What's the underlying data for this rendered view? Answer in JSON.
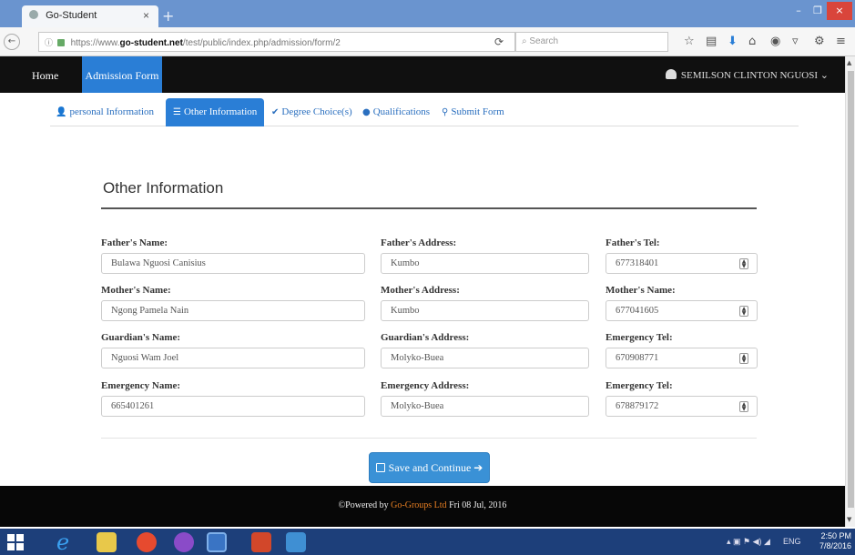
{
  "browser": {
    "tab_title": "Go-Student",
    "tab_close": "×",
    "new_tab": "+",
    "url_prefix": "https://www.",
    "url_domain": "go-student.net",
    "url_path": "/test/public/index.php/admission/form/2",
    "search_placeholder": "Search",
    "window_min": "–",
    "window_max": "❐",
    "window_close": "×"
  },
  "app": {
    "nav_home": "Home",
    "nav_admission": "Admission Form",
    "user_name": "SEMILSON CLINTON NGUOSI",
    "user_caret": "⌄"
  },
  "pills": [
    {
      "icon": "user-icon",
      "label": "personal Information"
    },
    {
      "icon": "list-icon",
      "label": "Other Information"
    },
    {
      "icon": "check-icon",
      "label": "Degree Choice(s)"
    },
    {
      "icon": "circle-icon",
      "label": "Qualifications"
    },
    {
      "icon": "pin-icon",
      "label": "Submit Form"
    }
  ],
  "form": {
    "title": "Other Information",
    "fields": [
      {
        "label": "Father's Name:",
        "value": "Bulawa Nguosi Canisius"
      },
      {
        "label": "Father's Address:",
        "value": "Kumbo"
      },
      {
        "label": "Father's Tel:",
        "value": "677318401"
      },
      {
        "label": "Mother's Name:",
        "value": "Ngong Pamela Nain"
      },
      {
        "label": "Mother's Address:",
        "value": "Kumbo"
      },
      {
        "label": "Mother's Name:",
        "value": "677041605"
      },
      {
        "label": "Guardian's Name:",
        "value": "Nguosi Wam Joel"
      },
      {
        "label": "Guardian's Address:",
        "value": "Molyko-Buea"
      },
      {
        "label": "Emergency Tel:",
        "value": "670908771"
      },
      {
        "label": "Emergency Name:",
        "value": "665401261"
      },
      {
        "label": "Emergency Address:",
        "value": "Molyko-Buea"
      },
      {
        "label": "Emergency Tel:",
        "value": "678879172"
      }
    ],
    "save_label": "Save and Continue ➔"
  },
  "footer": {
    "prefix": "©Powered by ",
    "brand": "Go-Groups Ltd",
    "suffix": " Fri 08 Jul, 2016"
  },
  "taskbar": {
    "lang": "ENG",
    "time": "2:50 PM",
    "date": "7/8/2016"
  },
  "colors": {
    "primary": "#2a7ed6",
    "navbar": "#101010",
    "footer_brand": "#e67e22"
  }
}
